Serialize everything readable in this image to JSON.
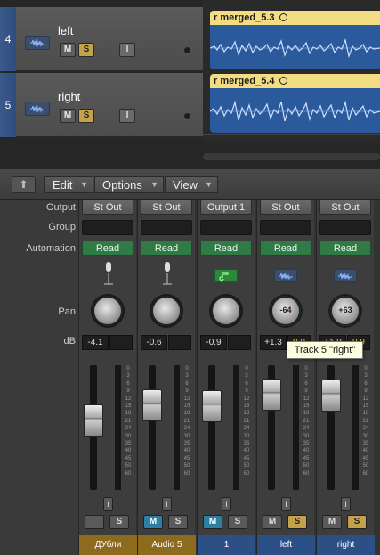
{
  "tracks": [
    {
      "number": "4",
      "name": "left",
      "mute": "M",
      "solo": "S",
      "input": "I",
      "region": "r merged_5.3"
    },
    {
      "number": "5",
      "name": "right",
      "mute": "M",
      "solo": "S",
      "input": "I",
      "region": "r merged_5.4"
    }
  ],
  "toolbar": {
    "up_icon": "up-arrow-icon",
    "edit": "Edit",
    "options": "Options",
    "view": "View"
  },
  "row_labels": {
    "output": "Output",
    "group": "Group",
    "automation": "Automation",
    "pan": "Pan",
    "db": "dB"
  },
  "strips": [
    {
      "output": "St Out",
      "automation": "Read",
      "icon": "microphone-icon",
      "pan": "",
      "db": "-4.1",
      "peak": "",
      "mute": "",
      "solo": "S",
      "input": "I",
      "name": "ДУбли",
      "name_color": "#8c6a1e"
    },
    {
      "output": "St Out",
      "automation": "Read",
      "icon": "microphone-icon",
      "pan": "",
      "db": "-0.6",
      "peak": "",
      "mute": "M",
      "solo": "S",
      "input": "I",
      "name": "Audio 5",
      "name_color": "#8c6a1e"
    },
    {
      "output": "Output 1",
      "automation": "Read",
      "icon": "music-note-icon",
      "pan": "",
      "db": "-0.9",
      "peak": "",
      "mute": "M",
      "solo": "S",
      "input": "I",
      "name": "1",
      "name_color": "#2c4f86"
    },
    {
      "output": "St Out",
      "automation": "Read",
      "icon": "waveform-icon",
      "pan": "-64",
      "db": "+1.3",
      "peak": "0.0",
      "mute": "M",
      "solo": "S",
      "input": "I",
      "name": "left",
      "name_color": "#2c4f86"
    },
    {
      "output": "St Out",
      "automation": "Read",
      "icon": "waveform-icon",
      "pan": "+63",
      "db": "+1.0",
      "peak": "0.9",
      "mute": "M",
      "solo": "S",
      "input": "I",
      "name": "right",
      "name_color": "#2c4f86"
    }
  ],
  "meter_scale": [
    "0",
    "3",
    "6",
    "9",
    "12",
    "15",
    "18",
    "21",
    "24",
    "30",
    "35",
    "40",
    "45",
    "50",
    "60"
  ],
  "tooltip": "Track 5 \"right\""
}
